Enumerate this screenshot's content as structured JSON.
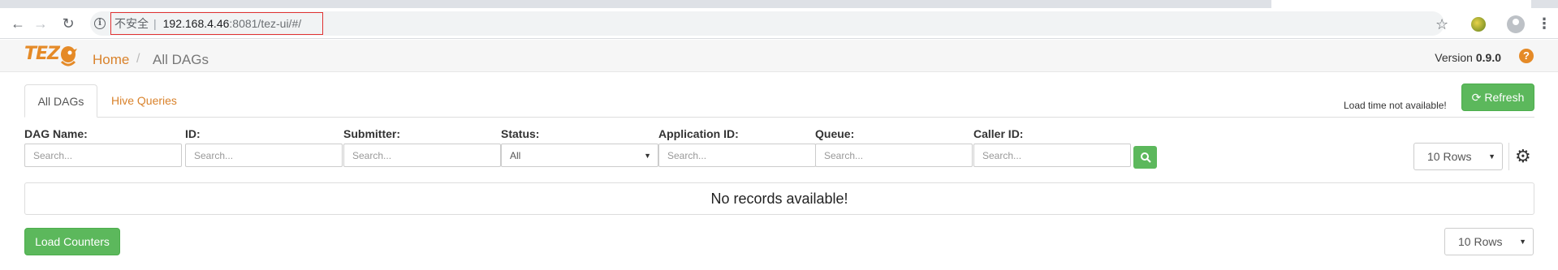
{
  "browser": {
    "url_insecure_label": "不安全",
    "url_separator": "|",
    "url_host": "192.168.4.46",
    "url_rest": ":8081/tez-ui/#/"
  },
  "header": {
    "logo_text": "TEZ",
    "breadcrumb_home": "Home",
    "breadcrumb_separator": "/",
    "breadcrumb_current": "All DAGs",
    "version_label": "Version",
    "version_number": "0.9.0",
    "help_icon": "?"
  },
  "tabs": {
    "all_dags": "All DAGs",
    "hive_queries": "Hive Queries"
  },
  "load_time_text": "Load time not available!",
  "refresh_label": "Refresh",
  "filters": [
    {
      "label": "DAG Name:",
      "placeholder": "Search...",
      "type": "input"
    },
    {
      "label": "ID:",
      "placeholder": "Search...",
      "type": "input"
    },
    {
      "label": "Submitter:",
      "placeholder": "Search...",
      "type": "input"
    },
    {
      "label": "Status:",
      "value": "All",
      "type": "select"
    },
    {
      "label": "Application ID:",
      "placeholder": "Search...",
      "type": "input"
    },
    {
      "label": "Queue:",
      "placeholder": "Search...",
      "type": "input"
    },
    {
      "label": "Caller ID:",
      "placeholder": "Search...",
      "type": "input"
    }
  ],
  "rows_select_top": "10 Rows",
  "rows_select_bottom": "10 Rows",
  "empty_message": "No records available!",
  "load_counters_label": "Load Counters",
  "colors": {
    "accent_orange": "#d9822b",
    "button_green": "#5cb85c",
    "url_highlight_border": "#e03131"
  }
}
